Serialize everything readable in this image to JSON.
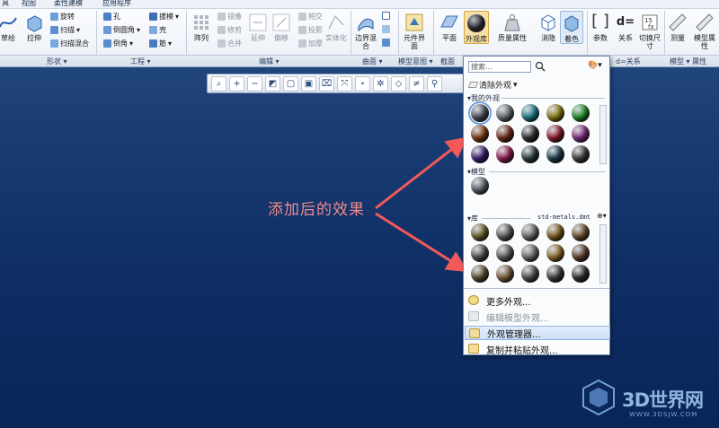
{
  "menubar": {
    "tabs": [
      "具",
      "视图",
      "柔性建模",
      "应用程序"
    ]
  },
  "ribbon": {
    "left": {
      "sweep": "草绘",
      "extrude": "拉伸",
      "revolve": "旋转",
      "sweep2": "扫描",
      "blend": "扫描混合"
    },
    "engineering": {
      "hole": "孔",
      "draft": "拔模",
      "round": "倒圆角",
      "shell": "壳",
      "chamfer": "倒角",
      "rib": "筋"
    },
    "editing": {
      "pattern": "阵列",
      "mirror": "镜像",
      "trim": "修剪",
      "merge": "合并",
      "extend": "延伸",
      "offset": "偏移",
      "intersect": "相交",
      "project": "投影",
      "thicken": "加厚",
      "solidify": "实体化"
    },
    "surface": {
      "boundary": "边界混合",
      "element": "元件界面"
    },
    "view": {
      "plane": "平面",
      "appearance": "外观库",
      "mass": "质量属性",
      "hidden": "消隐",
      "shade": "着色"
    },
    "model_intent": {
      "params": "参数",
      "relations": "关系",
      "d": "d=",
      "switch_dims": "切换尺寸"
    },
    "measure": {
      "measure": "测量",
      "model_props": "模型属性"
    }
  },
  "groups": {
    "shape": "形状 ▾",
    "engineering": "工程 ▾",
    "editing": "编辑 ▾",
    "surface": "曲面 ▾",
    "model_intent": "模型意图 ▾",
    "section": "截面",
    "relations": "d=关系",
    "model_props": "模型 ▾ 属性"
  },
  "annotation": "添加后的效果",
  "panel": {
    "search_placeholder": "搜索...",
    "clear": "清除外观",
    "my_appearances": "▾我的外观",
    "model": "▾模型",
    "library": "▾库",
    "library_file": "std-metals.dmt",
    "menu": [
      {
        "label": "更多外观...",
        "disabled": false,
        "highlight": false
      },
      {
        "label": "编辑模型外观...",
        "disabled": true,
        "highlight": false
      },
      {
        "label": "外观管理器...",
        "disabled": false,
        "highlight": true
      },
      {
        "label": "复制并粘贴外观...",
        "disabled": false,
        "highlight": false
      }
    ],
    "colors": {
      "my": [
        "#4a4e55",
        "#6a6d72",
        "#1d7a8a",
        "#8a7a12",
        "#1f8a2a",
        "#7a3a12",
        "#6a2a18",
        "#2a2a2a",
        "#8a1a2a",
        "#7a2a7a",
        "#3a1a6a",
        "#8a1a4a",
        "#2a3a3a",
        "#1a3a4a",
        "#3a3a3a"
      ],
      "model": [
        "#5a5e66"
      ],
      "library": [
        "#6a5a2a",
        "#5a5a5a",
        "#6a6a6a",
        "#7a5a1a",
        "#6a4a2a",
        "#4a4a4a",
        "#5a5a5a",
        "#6a6a6a",
        "#8a6a2a",
        "#5a3a2a",
        "#5a4a2a",
        "#7a5a3a",
        "#4a4a4a",
        "#3a3a3a",
        "#2a2a2a"
      ]
    }
  },
  "watermark": {
    "text": "3D世界网",
    "url": "WWW.3DSJW.COM"
  },
  "minitoolbar": [
    "⌕",
    "+",
    "−",
    "◩",
    "▢",
    "▣",
    "⌧",
    "⤧",
    "⋆",
    "✲",
    "◇",
    "≠",
    "⚲"
  ]
}
